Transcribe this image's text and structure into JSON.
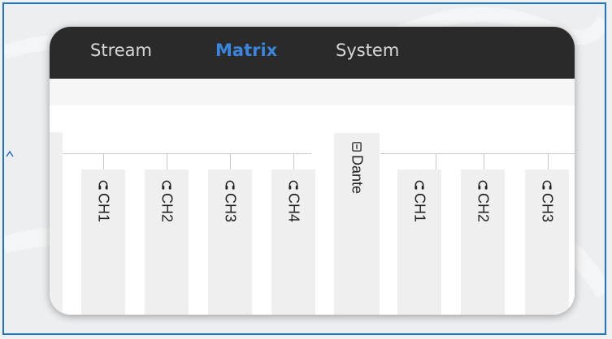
{
  "nav": {
    "tabs": [
      {
        "label": "Stream",
        "active": false
      },
      {
        "label": "Matrix",
        "active": true
      },
      {
        "label": "System",
        "active": false
      }
    ]
  },
  "matrix": {
    "group_label": "Dante",
    "columns_left": [
      {
        "label": "CH1",
        "icon": "headphones-icon"
      },
      {
        "label": "CH2",
        "icon": "headphones-icon"
      },
      {
        "label": "CH3",
        "icon": "headphones-icon"
      },
      {
        "label": "CH4",
        "icon": "headphones-icon"
      }
    ],
    "columns_right": [
      {
        "label": "CH1",
        "icon": "headphones-icon"
      },
      {
        "label": "CH2",
        "icon": "headphones-icon"
      },
      {
        "label": "CH3",
        "icon": "headphones-icon"
      }
    ]
  },
  "colors": {
    "frame_border": "#1b74c9",
    "nav_bg": "#2a2a2a",
    "active_tab": "#3a86df"
  }
}
